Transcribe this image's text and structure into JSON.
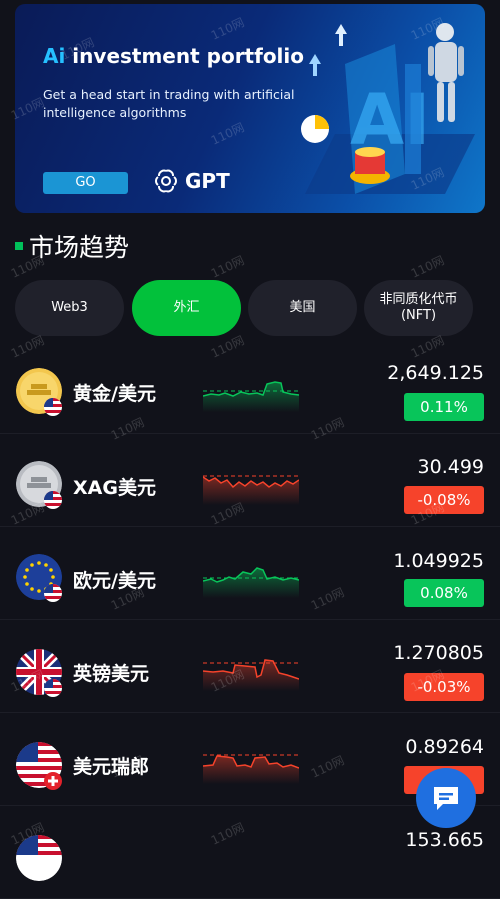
{
  "banner": {
    "title_prefix": "Ai",
    "title_rest": " investment portfolio",
    "subtitle": "Get a head start in trading with artificial intelligence algorithms",
    "go_label": "GO",
    "gpt_label": "GPT"
  },
  "section": {
    "title": "市场趋势"
  },
  "tabs": [
    {
      "label": "Web3",
      "active": false
    },
    {
      "label": "外汇",
      "active": true
    },
    {
      "label": "美国",
      "active": false
    },
    {
      "label": "非同质化代币\n(NFT)",
      "active": false
    }
  ],
  "markets": [
    {
      "name": "黄金/美元",
      "price": "2,649.125",
      "change": "0.11%",
      "direction": "up",
      "icon": "gold-bars-icon"
    },
    {
      "name": "XAG美元",
      "price": "30.499",
      "change": "-0.08%",
      "direction": "down",
      "icon": "silver-bars-icon"
    },
    {
      "name": "欧元/美元",
      "price": "1.049925",
      "change": "0.08%",
      "direction": "up",
      "icon": "eu-flag-icon"
    },
    {
      "name": "英镑美元",
      "price": "1.270805",
      "change": "-0.03%",
      "direction": "down",
      "icon": "uk-flag-icon"
    },
    {
      "name": "美元瑞郎",
      "price": "0.89264",
      "change": "",
      "direction": "down",
      "icon": "us-flag-icon"
    },
    {
      "name": "",
      "price": "153.665",
      "change": "",
      "direction": "up",
      "icon": "us-flag-icon"
    }
  ],
  "watermark": "110网",
  "colors": {
    "up": "#08c55a",
    "down": "#f6432b",
    "accent": "#02c13b",
    "background": "#11121a",
    "fab": "#1f6fe0"
  }
}
